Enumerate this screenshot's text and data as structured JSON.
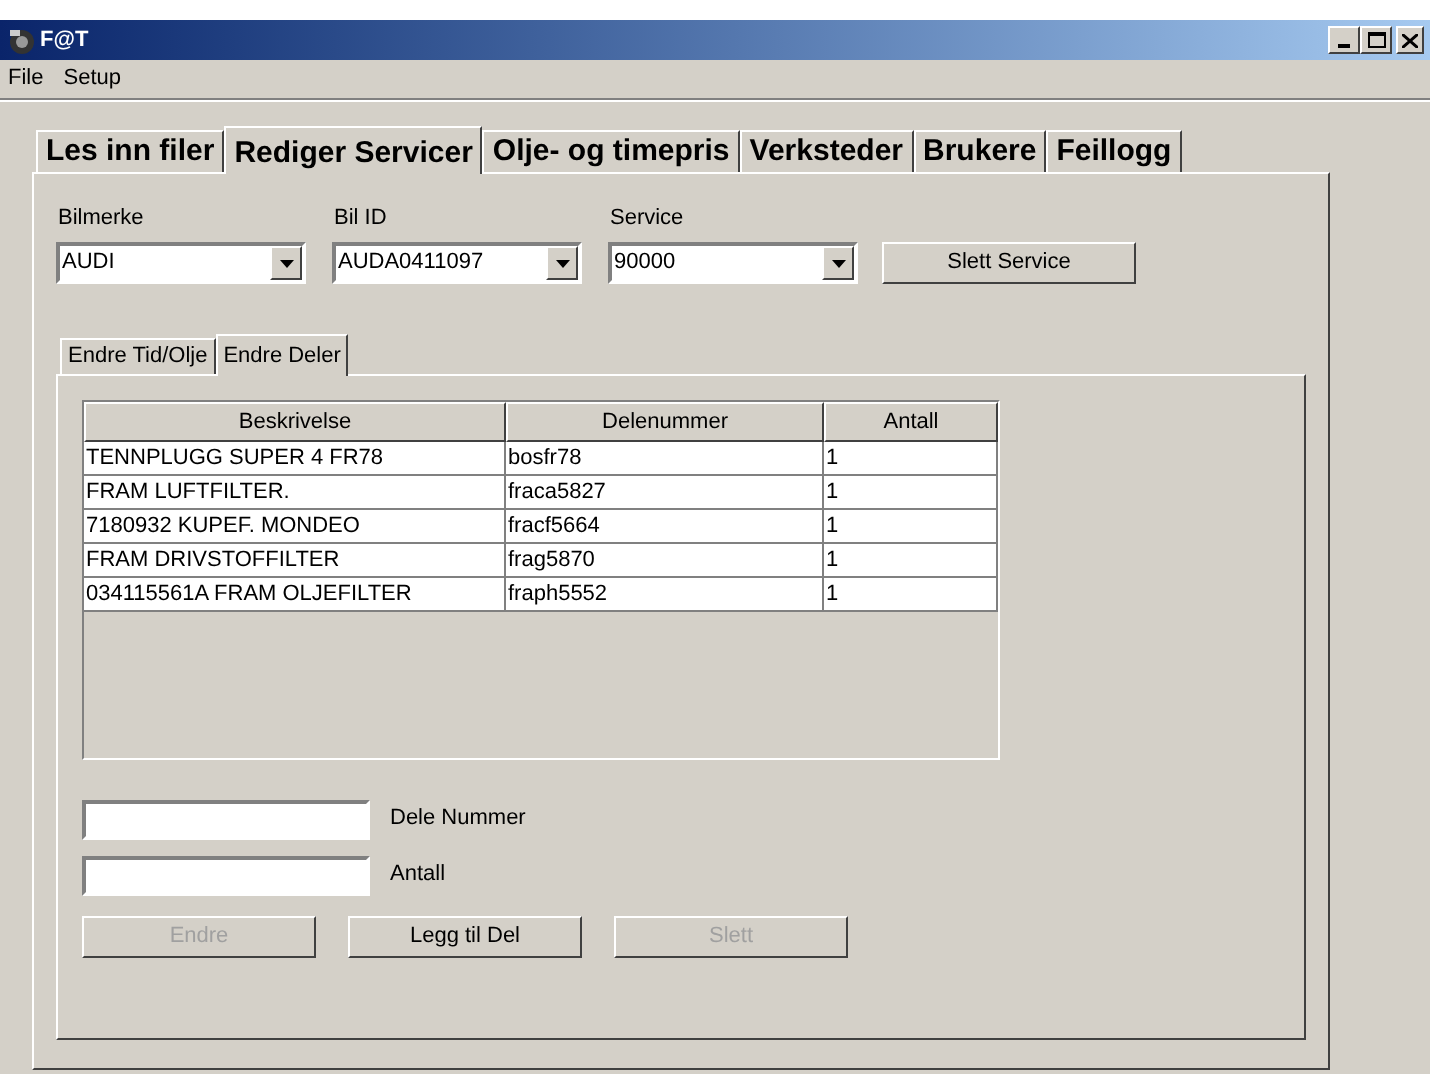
{
  "window": {
    "title": "F@T"
  },
  "menu": [
    "File",
    "Setup"
  ],
  "tabs": [
    {
      "label": "Les inn filer",
      "selected": false
    },
    {
      "label": "Rediger Servicer",
      "selected": true
    },
    {
      "label": "Olje- og timepris",
      "selected": false
    },
    {
      "label": "Verksteder",
      "selected": false
    },
    {
      "label": "Brukere",
      "selected": false
    },
    {
      "label": "Feillogg",
      "selected": false
    }
  ],
  "selectors": [
    {
      "label": "Bilmerke",
      "value": "AUDI"
    },
    {
      "label": "Bil ID",
      "value": "AUDA0411097"
    },
    {
      "label": "Service",
      "value": "90000"
    }
  ],
  "delete_service_button": {
    "label": "Slett Service",
    "disabled": false
  },
  "sub_tabs": [
    {
      "label": "Endre Tid/Olje",
      "selected": false
    },
    {
      "label": "Endre Deler",
      "selected": true
    }
  ],
  "table": {
    "columns": [
      "Beskrivelse",
      "Delenummer",
      "Antall"
    ],
    "rows": [
      [
        "TENNPLUGG SUPER 4 FR78",
        "bosfr78",
        "1"
      ],
      [
        "FRAM LUFTFILTER.",
        "fraca5827",
        "1"
      ],
      [
        "7180932 KUPEF. MONDEO",
        "fracf5664",
        "1"
      ],
      [
        "FRAM DRIVSTOFFILTER",
        "frag5870",
        "1"
      ],
      [
        "034115561A FRAM OLJEFILTER",
        "fraph5552",
        "1"
      ]
    ]
  },
  "inputs": [
    {
      "label": "Dele Nummer"
    },
    {
      "label": "Antall"
    }
  ],
  "buttons": [
    {
      "label": "Endre",
      "disabled": true
    },
    {
      "label": "Legg til Del",
      "disabled": false
    },
    {
      "label": "Slett",
      "disabled": true
    }
  ]
}
